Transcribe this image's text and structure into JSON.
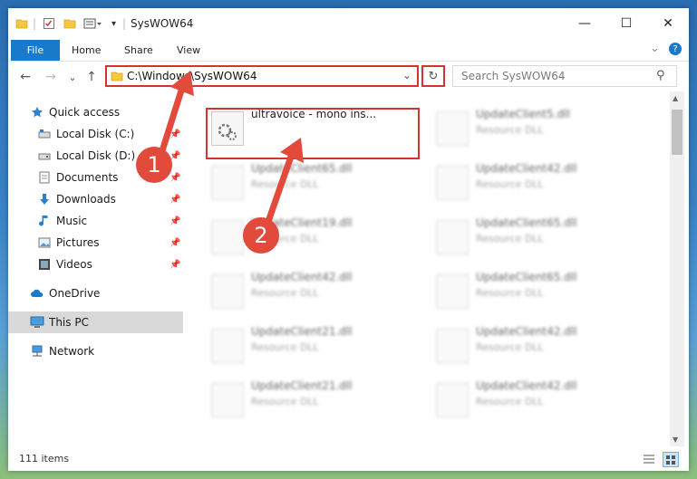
{
  "window": {
    "title": "SysWOW64",
    "controls": {
      "minimize": "—",
      "maximize": "☐",
      "close": "✕"
    }
  },
  "ribbon": {
    "tabs": [
      "File",
      "Home",
      "Share",
      "View"
    ],
    "expand": "⌄",
    "help": "?"
  },
  "navigation": {
    "back": "←",
    "forward": "→",
    "recent": "⌄",
    "up": "↑",
    "address": "C:\\Windows\\SysWOW64",
    "address_dropdown": "⌄",
    "refresh": "↻",
    "search_placeholder": "Search SysWOW64",
    "search_icon": "⚲"
  },
  "sidebar": {
    "items": [
      {
        "label": "Quick access",
        "icon": "star-icon"
      },
      {
        "label": "Local Disk (C:)",
        "icon": "drive-icon",
        "pinned": true
      },
      {
        "label": "Local Disk (D:)",
        "icon": "drive-icon",
        "pinned": true
      },
      {
        "label": "Documents",
        "icon": "documents-icon",
        "pinned": true
      },
      {
        "label": "Downloads",
        "icon": "download-icon",
        "pinned": true
      },
      {
        "label": "Music",
        "icon": "music-icon",
        "pinned": true
      },
      {
        "label": "Pictures",
        "icon": "pictures-icon",
        "pinned": true
      },
      {
        "label": "Videos",
        "icon": "videos-icon",
        "pinned": true
      },
      {
        "label": "OneDrive",
        "icon": "cloud-icon"
      },
      {
        "label": "This PC",
        "icon": "computer-icon",
        "selected": true
      },
      {
        "label": "Network",
        "icon": "network-icon"
      }
    ]
  },
  "files": {
    "col1": [
      {
        "name": "ultravoice - mono ins...",
        "type": ""
      },
      {
        "name": "UpdateClient65.dll",
        "type": "Resource DLL"
      },
      {
        "name": "UpdateClient19.dll",
        "type": "Resource DLL"
      },
      {
        "name": "UpdateClient42.dll",
        "type": "Resource DLL"
      },
      {
        "name": "UpdateClient21.dll",
        "type": "Resource DLL"
      },
      {
        "name": "UpdateClient21.dll",
        "type": "Resource DLL"
      }
    ],
    "col2": [
      {
        "name": "UpdateClient5.dll",
        "type": "Resource DLL"
      },
      {
        "name": "UpdateClient42.dll",
        "type": "Resource DLL"
      },
      {
        "name": "UpdateClient65.dll",
        "type": "Resource DLL"
      },
      {
        "name": "UpdateClient65.dll",
        "type": "Resource DLL"
      },
      {
        "name": "UpdateClient42.dll",
        "type": "Resource DLL"
      },
      {
        "name": "UpdateClient42.dll",
        "type": "Resource DLL"
      }
    ]
  },
  "status": {
    "item_count": "111 items"
  },
  "annotations": {
    "step1": "1",
    "step2": "2"
  },
  "colors": {
    "accent": "#1979ca",
    "highlight": "#d2352d",
    "arrow": "#e24a3b"
  }
}
